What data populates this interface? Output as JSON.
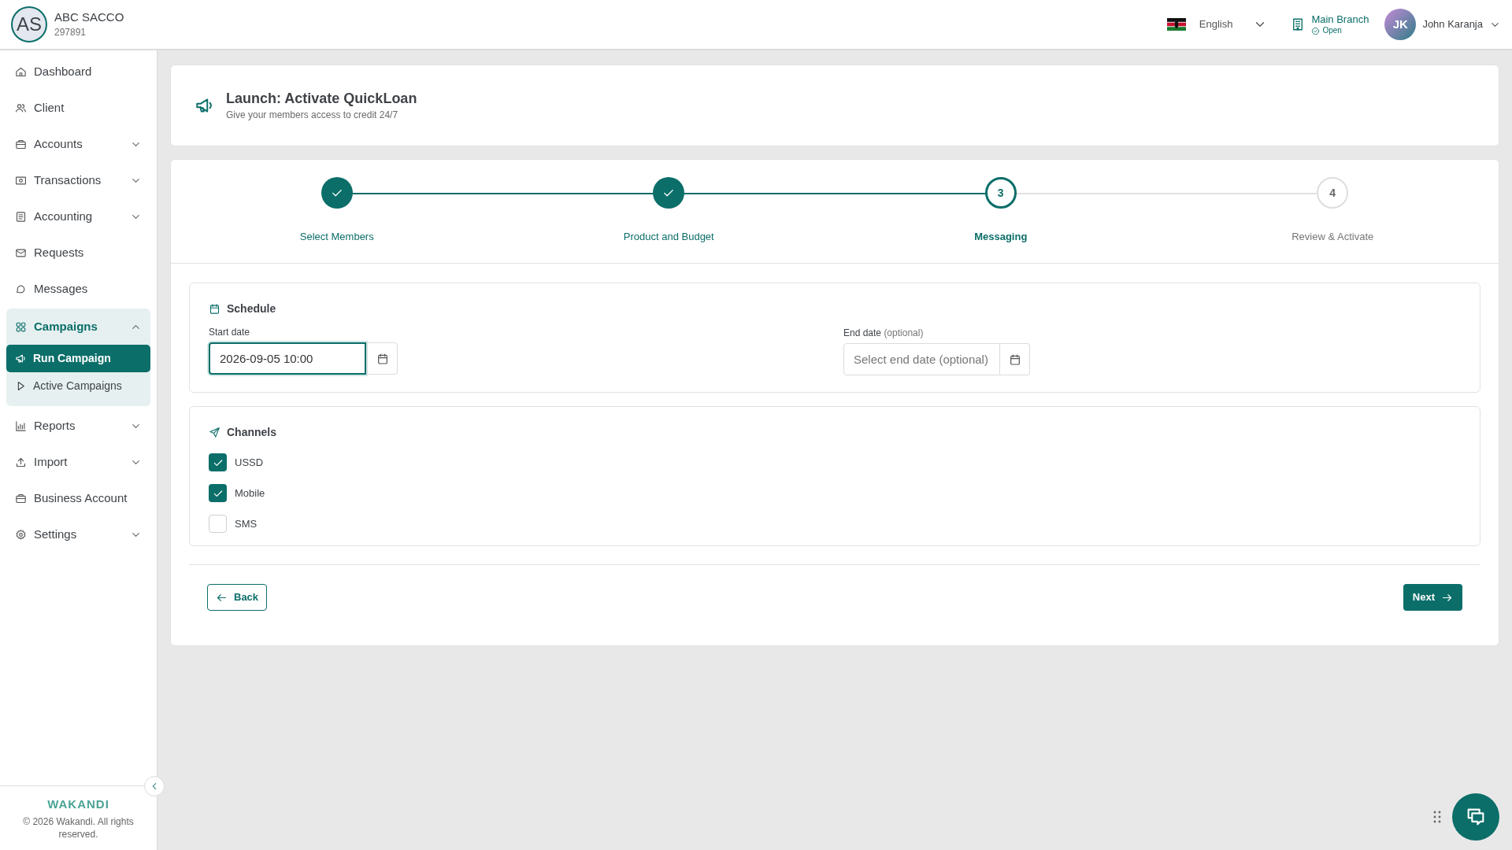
{
  "org": {
    "initials": "AS",
    "name": "ABC SACCO",
    "code": "297891"
  },
  "topbar": {
    "language": "English",
    "branch": {
      "name": "Main Branch",
      "status": "Open"
    },
    "user": {
      "initials": "JK",
      "name": "John Karanja"
    }
  },
  "sidebar": {
    "items": [
      {
        "label": "Dashboard",
        "selected": false
      },
      {
        "label": "Client",
        "selected": false
      },
      {
        "label": "Accounts",
        "expanded": false,
        "selected": false
      },
      {
        "label": "Transactions",
        "expanded": false,
        "selected": false
      },
      {
        "label": "Accounting",
        "expanded": false,
        "selected": false
      },
      {
        "label": "Requests",
        "selected": false
      },
      {
        "label": "Messages",
        "selected": false
      },
      {
        "label": "Campaigns",
        "expanded": true,
        "selected": true,
        "children": [
          {
            "label": "Run Campaign",
            "selected": true
          },
          {
            "label": "Active Campaigns",
            "selected": false
          }
        ]
      },
      {
        "label": "Reports",
        "expanded": false,
        "selected": false
      },
      {
        "label": "Import",
        "expanded": false,
        "selected": false
      },
      {
        "label": "Business Account",
        "selected": false
      },
      {
        "label": "Settings",
        "expanded": false,
        "selected": false
      }
    ],
    "brand": "WAKANDI",
    "copyright": "© 2026 Wakandi. All rights reserved."
  },
  "page": {
    "title": "Launch: Activate QuickLoan",
    "subtitle": "Give your members access to credit 24/7"
  },
  "steps": [
    {
      "label": "Select Members",
      "completed": true,
      "selected": false
    },
    {
      "label": "Product and Budget",
      "completed": true,
      "selected": false
    },
    {
      "label": "Messaging",
      "number": "3",
      "completed": false,
      "selected": true
    },
    {
      "label": "Review & Activate",
      "number": "4",
      "completed": false,
      "selected": false
    }
  ],
  "schedule": {
    "title": "Schedule",
    "start": {
      "label": "Start date",
      "value": "2026-09-05 10:00"
    },
    "end": {
      "label": "End date",
      "hint": "(optional)",
      "placeholder": "Select end date (optional)"
    }
  },
  "channels": {
    "title": "Channels",
    "items": [
      {
        "label": "USSD",
        "checked": true
      },
      {
        "label": "Mobile",
        "checked": true
      },
      {
        "label": "SMS",
        "checked": false
      }
    ]
  },
  "buttons": {
    "back": "Back",
    "next": "Next"
  }
}
